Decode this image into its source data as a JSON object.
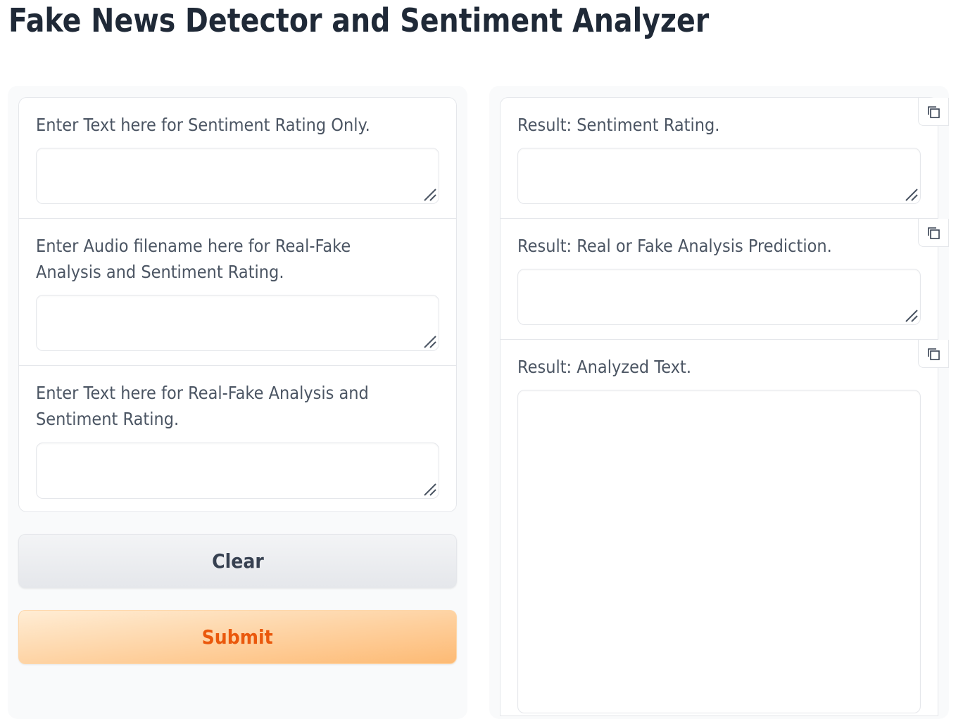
{
  "header": {
    "title": "Fake News Detector and Sentiment Analyzer"
  },
  "inputs": [
    {
      "label": "Enter Text here for Sentiment Rating Only.",
      "value": ""
    },
    {
      "label": "Enter Audio filename here for Real-Fake Analysis and Sentiment Rating.",
      "value": ""
    },
    {
      "label": "Enter Text here for Real-Fake Analysis and Sentiment Rating.",
      "value": ""
    }
  ],
  "buttons": {
    "clear_label": "Clear",
    "submit_label": "Submit"
  },
  "outputs": [
    {
      "label": "Result: Sentiment Rating.",
      "value": ""
    },
    {
      "label": "Result: Real or Fake Analysis Prediction.",
      "value": ""
    },
    {
      "label": "Result: Analyzed Text.",
      "value": ""
    }
  ],
  "icons": {
    "copy": "copy-icon",
    "resize": "resize-handle-icon"
  },
  "colors": {
    "submit_text": "#ea580c",
    "submit_bg": "#fdba74",
    "clear_bg": "#e5e7eb"
  }
}
